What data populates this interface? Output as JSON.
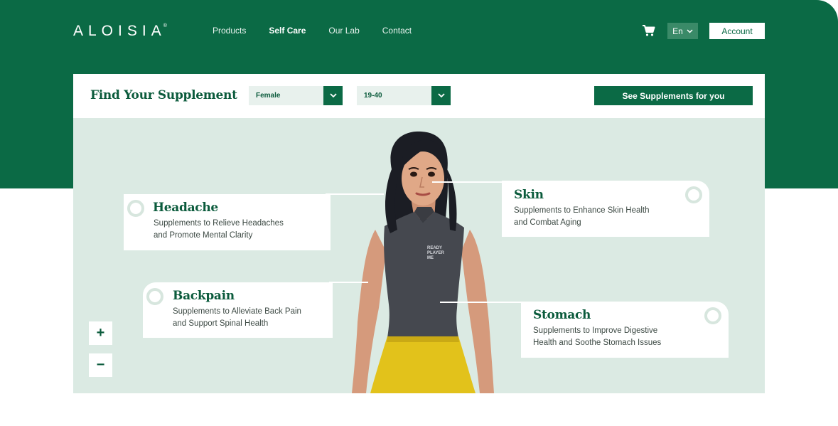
{
  "brand": {
    "name": "ALOISIA",
    "mark": "®"
  },
  "nav": {
    "items": [
      {
        "label": "Products"
      },
      {
        "label": "Self Care"
      },
      {
        "label": "Our Lab"
      },
      {
        "label": "Contact"
      }
    ],
    "active": "Self Care"
  },
  "header": {
    "cart_icon": "cart-icon",
    "language": "En",
    "account_label": "Account"
  },
  "finder": {
    "title": "Find Your Supplement",
    "gender_value": "Female",
    "age_value": "19-40",
    "cta_label": "See Supplements for you"
  },
  "hotspots": {
    "headache": {
      "title": "Headache",
      "desc1": "Supplements to Relieve Headaches",
      "desc2": "and Promote Mental Clarity"
    },
    "skin": {
      "title": "Skin",
      "desc1": "Supplements to Enhance Skin Health",
      "desc2": "and Combat Aging"
    },
    "backpain": {
      "title": "Backpain",
      "desc1": "Supplements to Alleviate Back Pain",
      "desc2": "and Support Spinal Health"
    },
    "stomach": {
      "title": "Stomach",
      "desc1": "Supplements to Improve Digestive",
      "desc2": "Health and Soothe Stomach Issues"
    }
  },
  "shirt_print": "READY PLAYER ME",
  "zoom": {
    "in": "+",
    "out": "−"
  },
  "colors": {
    "brand_green": "#0b6a45",
    "stage_bg": "#dbeae3",
    "skirt_yellow": "#e2c21b"
  }
}
